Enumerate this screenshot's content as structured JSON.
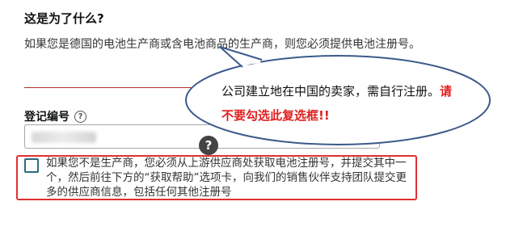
{
  "section": {
    "title": "这是为了什么?",
    "description": "如果您是德国的电池生产商或含电池商品的生产商，则您必须提供电池注册号。"
  },
  "registration": {
    "label": "登记编号",
    "help_icon": "question-circle-icon",
    "help_glyph": "?"
  },
  "tooltip": {
    "glyph": "?"
  },
  "checkbox": {
    "checked": false,
    "text": "如果您不是生产商，您必须从上游供应商处获取电池注册号，并提交其中一个，然后前往下方的“获取帮助”选项卡，向我们的销售伙伴支持团队提交更多的供应商信息，包括任何其他注册号"
  },
  "callout": {
    "text": "公司建立地在中国的卖家，需自行注册。",
    "warning": "请不要勾选此复选框!!",
    "highlight_color": "#e03030",
    "warning_color": "#e02020"
  }
}
